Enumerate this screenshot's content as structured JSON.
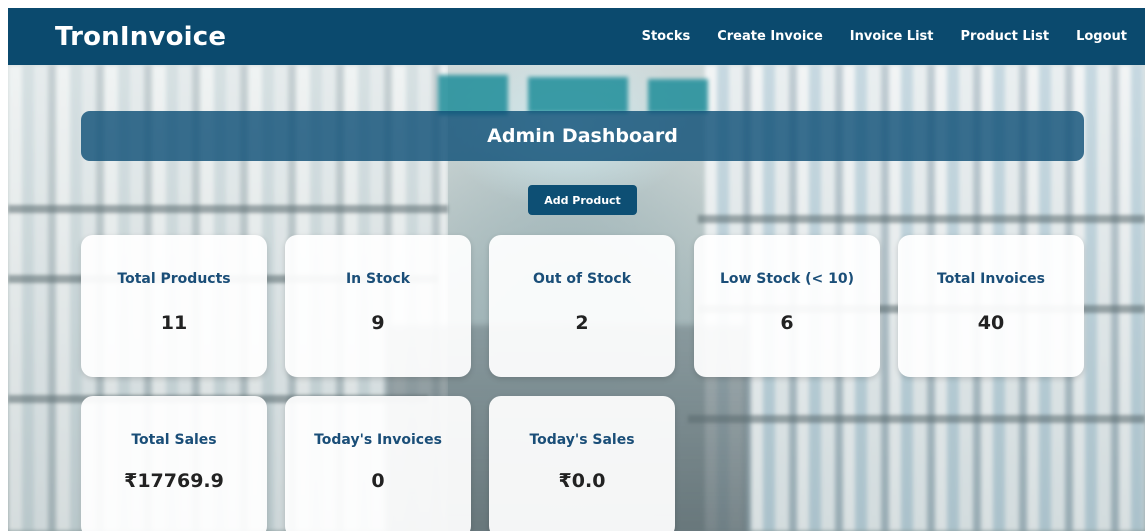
{
  "navbar": {
    "brand": "TronInvoice",
    "links": [
      {
        "label": "Stocks"
      },
      {
        "label": "Create Invoice"
      },
      {
        "label": "Invoice List"
      },
      {
        "label": "Product List"
      },
      {
        "label": "Logout"
      }
    ]
  },
  "dashboard": {
    "title": "Admin Dashboard",
    "add_product_label": "Add Product"
  },
  "stats": [
    {
      "label": "Total Products",
      "value": "11"
    },
    {
      "label": "In Stock",
      "value": "9"
    },
    {
      "label": "Out of Stock",
      "value": "2"
    },
    {
      "label": "Low Stock (< 10)",
      "value": "6"
    },
    {
      "label": "Total Invoices",
      "value": "40"
    },
    {
      "label": "Total Sales",
      "value": "₹17769.9"
    },
    {
      "label": "Today's Invoices",
      "value": "0"
    },
    {
      "label": "Today's Sales",
      "value": "₹0.0"
    }
  ],
  "colors": {
    "navbar": "#0b4a6e",
    "header_bar": "#105078",
    "button": "#0d4f74",
    "card_label": "#1a4e78",
    "card_value": "#222222"
  }
}
